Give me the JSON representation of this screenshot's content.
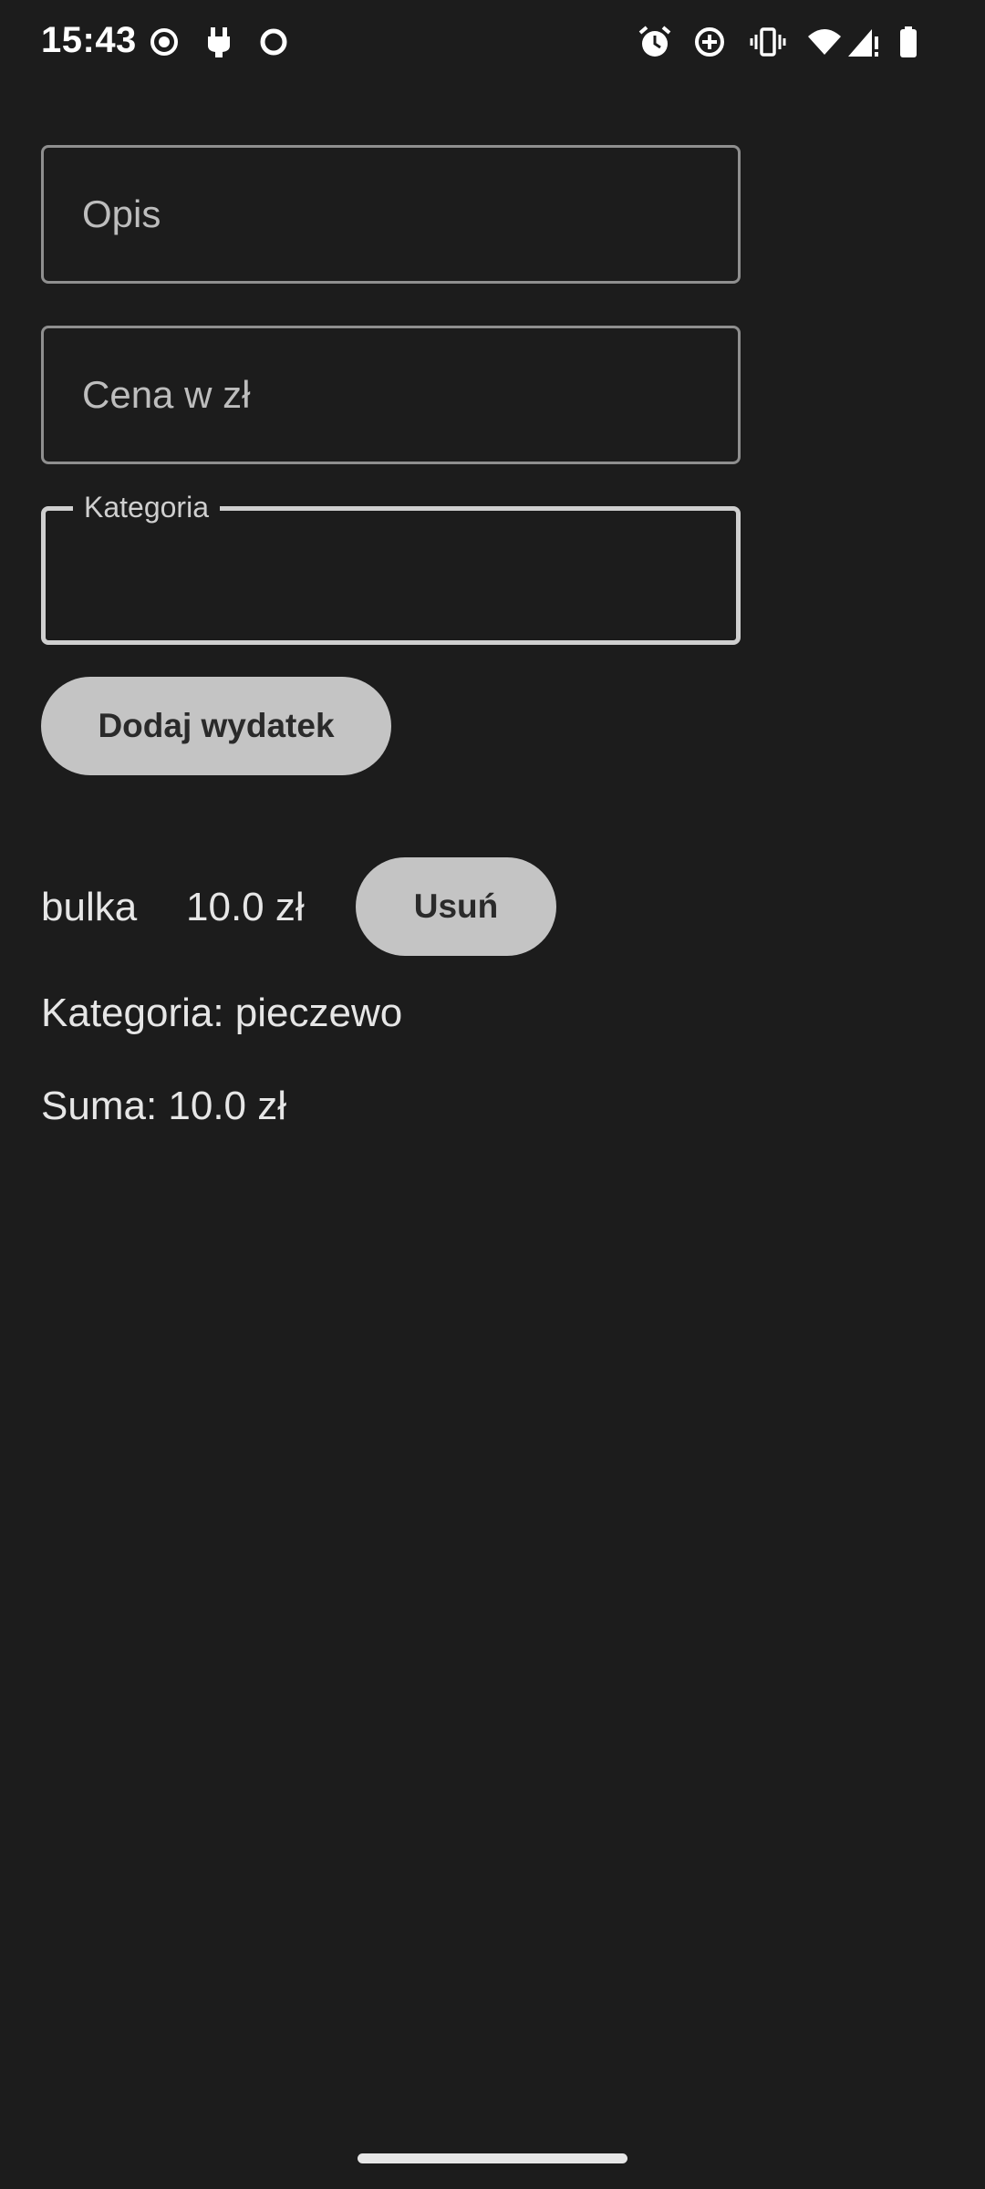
{
  "status_bar": {
    "time": "15:43",
    "left_icons": [
      "record-icon",
      "plug-icon",
      "circle-icon"
    ],
    "right_icons": [
      "alarm-icon",
      "data-saver-icon",
      "vibrate-icon",
      "wifi-icon",
      "signal-icon",
      "battery-icon"
    ]
  },
  "form": {
    "description_placeholder": "Opis",
    "price_placeholder": "Cena w zł",
    "category_label": "Kategoria",
    "category_value": "",
    "add_button_label": "Dodaj wydatek"
  },
  "expenses": [
    {
      "description": "bulka",
      "price": "10.0 zł",
      "remove_label": "Usuń",
      "category_text": "Kategoria: pieczewo"
    }
  ],
  "total_text": "Suma: 10.0 zł",
  "colors": {
    "background": "#1c1c1c",
    "text": "#e6e6e6",
    "button_bg": "#c4c4c4",
    "button_text": "#2a2a2a",
    "outline": "#8f8f8f"
  }
}
